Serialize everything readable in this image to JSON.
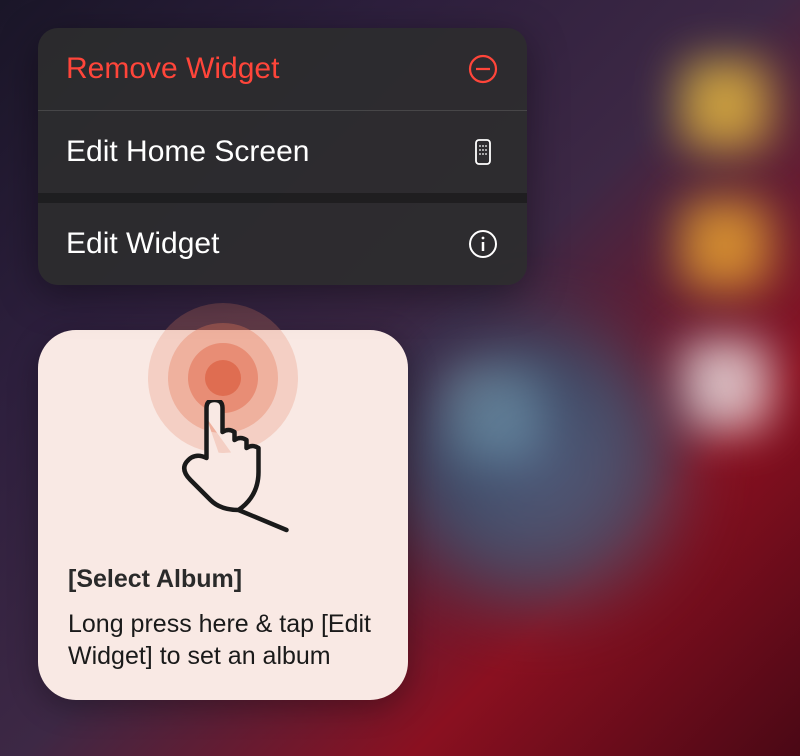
{
  "context_menu": {
    "items": [
      {
        "label": "Remove Widget",
        "icon": "remove-icon",
        "destructive": true
      },
      {
        "label": "Edit Home Screen",
        "icon": "home-screen-icon",
        "destructive": false
      },
      {
        "label": "Edit Widget",
        "icon": "info-icon",
        "destructive": false
      }
    ]
  },
  "widget": {
    "title": "[Select Album]",
    "instruction": "Long press here & tap [Edit Widget] to set an album"
  },
  "colors": {
    "destructive": "#ff453a",
    "text_light": "#ffffff",
    "widget_bg": "#f9e9e4"
  }
}
